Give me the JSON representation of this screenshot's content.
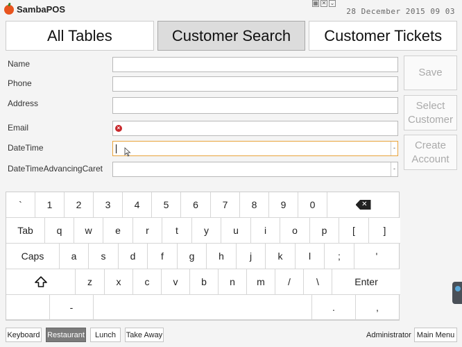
{
  "app": {
    "name": "SambaPOS",
    "clock": "28 December 2015 09 03"
  },
  "tabs": [
    {
      "label": "All Tables",
      "active": false
    },
    {
      "label": "Customer Search",
      "active": true
    },
    {
      "label": "Customer Tickets",
      "active": false
    }
  ],
  "form": {
    "fields": [
      {
        "label": "Name",
        "value": ""
      },
      {
        "label": "Phone",
        "value": ""
      },
      {
        "label": "Address",
        "value": ""
      },
      {
        "label": "Email",
        "value": ""
      },
      {
        "label": "DateTime",
        "value": ""
      },
      {
        "label": "DateTimeAdvancingCaret",
        "value": ""
      }
    ]
  },
  "actions": {
    "save": "Save",
    "select_customer": "Select\nCustomer",
    "create_account": "Create\nAccount"
  },
  "keyboard": {
    "row1": [
      "`",
      "1",
      "2",
      "3",
      "4",
      "5",
      "6",
      "7",
      "8",
      "9",
      "0",
      "backspace"
    ],
    "row2": [
      "Tab",
      "q",
      "w",
      "e",
      "r",
      "t",
      "y",
      "u",
      "i",
      "o",
      "p",
      "[",
      "]"
    ],
    "row3": [
      "Caps",
      "a",
      "s",
      "d",
      "f",
      "g",
      "h",
      "j",
      "k",
      "l",
      ";",
      "'"
    ],
    "row4": [
      "shift",
      "z",
      "x",
      "c",
      "v",
      "b",
      "n",
      "m",
      "/",
      "\\",
      "Enter"
    ],
    "row5": [
      "",
      "-",
      "",
      ".",
      ","
    ]
  },
  "bottom": {
    "keyboard": "Keyboard",
    "restaurant": "Restaurant",
    "lunch": "Lunch",
    "take_away": "Take Away",
    "user": "Administrator",
    "main_menu": "Main Menu"
  },
  "colors": {
    "focus": "#e8a33a",
    "error": "#c8272b",
    "active_tab": "#dcdcdc"
  }
}
